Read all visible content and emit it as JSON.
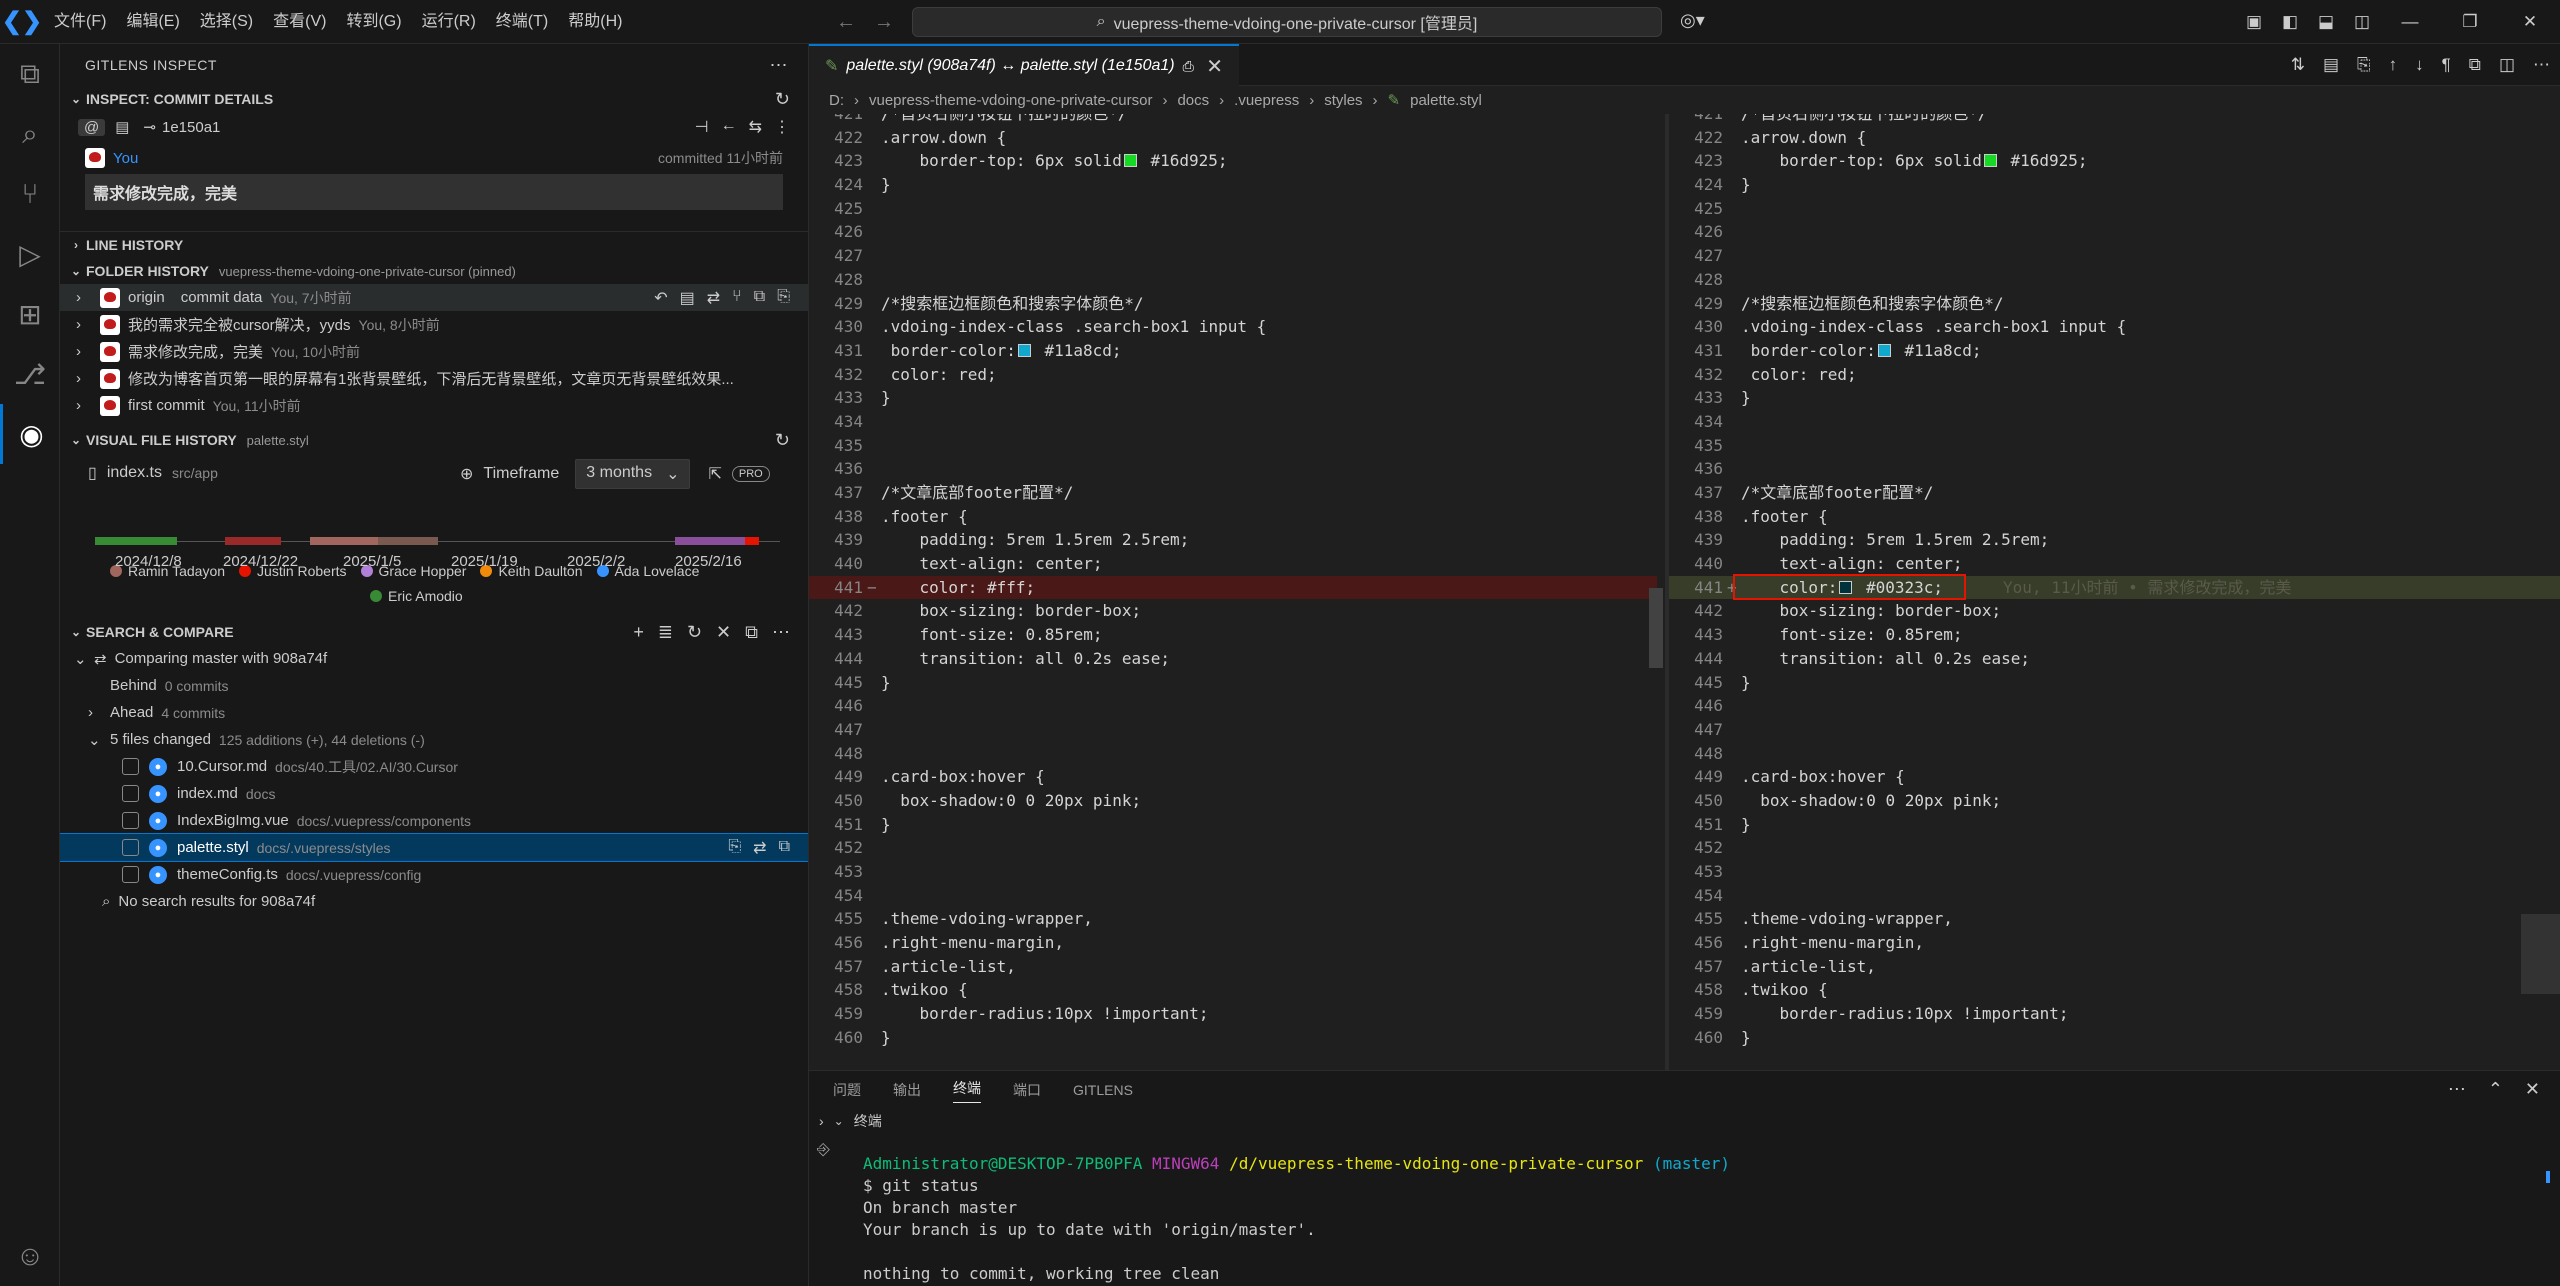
{
  "titlebar": {
    "menus": [
      "文件(F)",
      "编辑(E)",
      "选择(S)",
      "查看(V)",
      "转到(G)",
      "运行(R)",
      "终端(T)",
      "帮助(H)"
    ],
    "command_center": "vuepress-theme-vdoing-one-private-cursor [管理员]"
  },
  "sidebar": {
    "title": "GITLENS INSPECT",
    "commit_details": {
      "header": "INSPECT: COMMIT DETAILS",
      "sha": "1e150a1",
      "author": "You",
      "committed": "committed 11小时前",
      "message": "需求修改完成，完美"
    },
    "line_history": "LINE HISTORY",
    "folder_history": {
      "header": "FOLDER HISTORY",
      "desc": "vuepress-theme-vdoing-one-private-cursor (pinned)",
      "items": [
        {
          "badge": "origin",
          "msg": "commit data",
          "meta": "You, 7小时前"
        },
        {
          "msg": "我的需求完全被cursor解决，yyds",
          "meta": "You, 8小时前"
        },
        {
          "msg": "需求修改完成，完美",
          "meta": "You, 10小时前"
        },
        {
          "msg": "修改为博客首页第一眼的屏幕有1张背景壁纸，下滑后无背景壁纸，文章页无背景壁纸效果...",
          "meta": ""
        },
        {
          "msg": "first commit",
          "meta": "You, 11小时前"
        }
      ]
    },
    "visual_history": {
      "header": "VISUAL FILE HISTORY",
      "desc": "palette.styl",
      "file": "index.ts",
      "file_path": "src/app",
      "timeframe_label": "Timeframe",
      "timeframe_value": "3 months",
      "pro": "PRO",
      "dates": [
        "2024/12/8",
        "2024/12/22",
        "2025/1/5",
        "2025/1/19",
        "2025/2/2",
        "2025/2/16"
      ],
      "authors": [
        {
          "name": "Ramin Tadayon",
          "color": "#a1665e"
        },
        {
          "name": "Justin Roberts",
          "color": "#e51400"
        },
        {
          "name": "Grace Hopper",
          "color": "#b180d7"
        },
        {
          "name": "Keith Daulton",
          "color": "#f28b0c"
        },
        {
          "name": "Ada Lovelace",
          "color": "#3794ff"
        },
        {
          "name": "Eric Amodio",
          "color": "#388a34"
        }
      ]
    },
    "search_compare": {
      "header": "SEARCH & COMPARE",
      "comparing": "Comparing master with 908a74f",
      "behind": "Behind",
      "behind_count": "0 commits",
      "ahead": "Ahead",
      "ahead_count": "4 commits",
      "changed": "5 files changed",
      "changed_stats": "125 additions (+), 44 deletions (-)",
      "files": [
        {
          "name": "10.Cursor.md",
          "path": "docs/40.工具/02.AI/30.Cursor"
        },
        {
          "name": "index.md",
          "path": "docs"
        },
        {
          "name": "IndexBigImg.vue",
          "path": "docs/.vuepress/components"
        },
        {
          "name": "palette.styl",
          "path": "docs/.vuepress/styles"
        },
        {
          "name": "themeConfig.ts",
          "path": "docs/.vuepress/config"
        }
      ],
      "no_results": "No search results for 908a74f"
    }
  },
  "editor": {
    "tab": "palette.styl (908a74f) ↔ palette.styl (1e150a1)",
    "breadcrumb": [
      "D:",
      "vuepress-theme-vdoing-one-private-cursor",
      "docs",
      ".vuepress",
      "styles",
      "palette.styl"
    ],
    "blame": "You, 11小时前 • 需求修改完成，完美"
  },
  "code_left": [
    {
      "n": "421",
      "t": "/*首页右侧小按钮下拉时的颜色*/"
    },
    {
      "n": "422",
      "t": ".arrow.down {"
    },
    {
      "n": "423",
      "t": "    border-top: 6px solid",
      "sw": "#16d925",
      "after": " #16d925;"
    },
    {
      "n": "424",
      "t": "}"
    },
    {
      "n": "425",
      "t": ""
    },
    {
      "n": "426",
      "t": ""
    },
    {
      "n": "427",
      "t": ""
    },
    {
      "n": "428",
      "t": ""
    },
    {
      "n": "429",
      "t": "/*搜索框边框颜色和搜索字体颜色*/"
    },
    {
      "n": "430",
      "t": ".vdoing-index-class .search-box1 input {"
    },
    {
      "n": "431",
      "t": " border-color:",
      "sw": "#11a8cd",
      "after": " #11a8cd;"
    },
    {
      "n": "432",
      "t": " color: red;"
    },
    {
      "n": "433",
      "t": "}"
    },
    {
      "n": "434",
      "t": ""
    },
    {
      "n": "435",
      "t": ""
    },
    {
      "n": "436",
      "t": ""
    },
    {
      "n": "437",
      "t": "/*文章底部footer配置*/"
    },
    {
      "n": "438",
      "t": ".footer {"
    },
    {
      "n": "439",
      "t": "    padding: 5rem 1.5rem 2.5rem;"
    },
    {
      "n": "440",
      "t": "    text-align: center;"
    },
    {
      "n": "441",
      "t": "    color: #fff;",
      "mark": "del"
    },
    {
      "n": "442",
      "t": "    box-sizing: border-box;"
    },
    {
      "n": "443",
      "t": "    font-size: 0.85rem;"
    },
    {
      "n": "444",
      "t": "    transition: all 0.2s ease;"
    },
    {
      "n": "445",
      "t": "}"
    },
    {
      "n": "446",
      "t": ""
    },
    {
      "n": "447",
      "t": ""
    },
    {
      "n": "448",
      "t": ""
    },
    {
      "n": "449",
      "t": ".card-box:hover {"
    },
    {
      "n": "450",
      "t": "  box-shadow:0 0 20px pink;"
    },
    {
      "n": "451",
      "t": "}"
    },
    {
      "n": "452",
      "t": ""
    },
    {
      "n": "453",
      "t": ""
    },
    {
      "n": "454",
      "t": ""
    },
    {
      "n": "455",
      "t": ".theme-vdoing-wrapper,"
    },
    {
      "n": "456",
      "t": ".right-menu-margin,"
    },
    {
      "n": "457",
      "t": ".article-list,"
    },
    {
      "n": "458",
      "t": ".twikoo {"
    },
    {
      "n": "459",
      "t": "    border-radius:10px !important;"
    },
    {
      "n": "460",
      "t": "}"
    }
  ],
  "code_right_441": {
    "t": "    color:",
    "sw": "#00323c",
    "after": " #00323c;"
  },
  "panel": {
    "tabs": [
      "问题",
      "输出",
      "终端",
      "端口",
      "GITLENS"
    ],
    "active": "终端",
    "term_label": "终端",
    "lines": {
      "user": "Administrator@DESKTOP-7PB0PFA",
      "env": "MINGW64",
      "path": "/d/vuepress-theme-vdoing-one-private-cursor",
      "branch": "(master)",
      "cmd": "$ git status",
      "o1": "On branch master",
      "o2": "Your branch is up to date with 'origin/master'.",
      "o3": "nothing to commit, working tree clean"
    }
  }
}
